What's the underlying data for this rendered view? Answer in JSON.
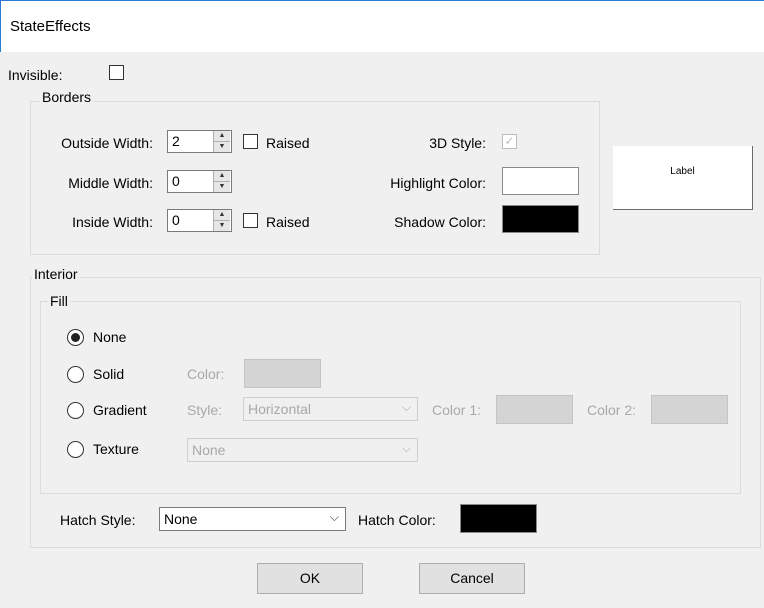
{
  "window": {
    "title": "StateEffects"
  },
  "invisible": {
    "label": "Invisible:",
    "checked": false
  },
  "borders": {
    "group_label": "Borders",
    "outside_width": {
      "label": "Outside Width:",
      "value": "2",
      "raised_label": "Raised",
      "raised_checked": false
    },
    "middle_width": {
      "label": "Middle Width:",
      "value": "0"
    },
    "inside_width": {
      "label": "Inside Width:",
      "value": "0",
      "raised_label": "Raised",
      "raised_checked": false
    },
    "style_3d": {
      "label": "3D Style:",
      "checked": true,
      "mark": "✓"
    },
    "highlight_color": {
      "label": "Highlight Color:",
      "color": "#ffffff"
    },
    "shadow_color": {
      "label": "Shadow Color:",
      "color": "#000000"
    }
  },
  "preview": {
    "label": "Label"
  },
  "interior": {
    "group_label": "Interior",
    "fill": {
      "group_label": "Fill",
      "options": [
        {
          "label": "None",
          "selected": true
        },
        {
          "label": "Solid",
          "selected": false
        },
        {
          "label": "Gradient",
          "selected": false
        },
        {
          "label": "Texture",
          "selected": false
        }
      ],
      "solid_color_label": "Color:",
      "solid_color": "#d4d4d4",
      "gradient_style_label": "Style:",
      "gradient_style_value": "Horizontal",
      "gradient_color1_label": "Color 1:",
      "gradient_color1": "#d4d4d4",
      "gradient_color2_label": "Color 2:",
      "gradient_color2": "#d4d4d4",
      "texture_value": "None"
    },
    "hatch_style_label": "Hatch Style:",
    "hatch_style_value": "None",
    "hatch_color_label": "Hatch Color:",
    "hatch_color": "#000000"
  },
  "buttons": {
    "ok": "OK",
    "cancel": "Cancel"
  }
}
